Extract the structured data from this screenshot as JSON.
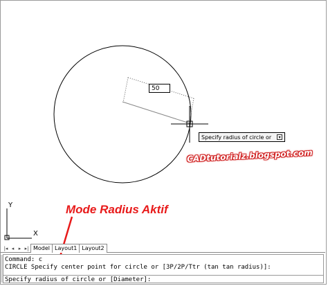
{
  "drawing": {
    "dynamic_input_value": "50",
    "tooltip_text": "Specify radius of circle or",
    "tooltip_arrow_icon": "down-arrow-icon",
    "watermark": "CADtutorialz.blogspot.com",
    "annotation": "Mode Radius Aktif",
    "ucs_y_label": "Y",
    "ucs_x_label": "X"
  },
  "layout_tabs": {
    "nav_icons": [
      "first-icon",
      "prev-icon",
      "next-icon",
      "last-icon"
    ],
    "tabs": [
      {
        "label": "Model",
        "active": true
      },
      {
        "label": "Layout1",
        "active": false
      },
      {
        "label": "Layout2",
        "active": false
      }
    ]
  },
  "command_window": {
    "history": [
      "Command: c",
      "CIRCLE Specify center point for circle or [3P/2P/Ttr (tan tan radius)]:"
    ],
    "prompt": "Specify radius of circle or [Diameter]:"
  },
  "colors": {
    "annotation": "#e81a1a",
    "watermark_outline": "#d02020"
  }
}
